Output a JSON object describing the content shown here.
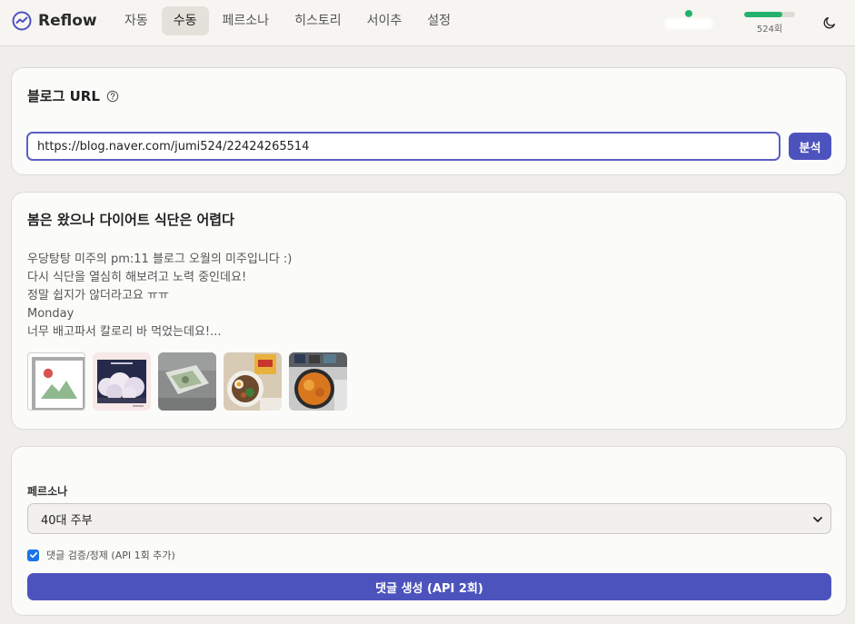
{
  "app": {
    "name": "Reflow"
  },
  "nav": {
    "tabs": [
      {
        "label": "자동",
        "active": false
      },
      {
        "label": "수동",
        "active": true
      },
      {
        "label": "페르소나",
        "active": false
      },
      {
        "label": "히스토리",
        "active": false
      },
      {
        "label": "서이추",
        "active": false
      },
      {
        "label": "설정",
        "active": false
      }
    ]
  },
  "status": {
    "connected": true
  },
  "usage": {
    "label": "524회",
    "fill_fraction": 0.75
  },
  "url_section": {
    "title": "블로그 URL",
    "url_value": "https://blog.naver.com/jumi524/22424265514",
    "analyze_label": "분석"
  },
  "post": {
    "title": "봄은 왔으나 다이어트 식단은 어렵다",
    "excerpt_lines": [
      "우당탕탕 미주의 pm:11 블로그 오월의 미주입니다 :)",
      "다시 식단을 열심히 해보려고 노력 중인데요!",
      "정말 쉽지가 않더라고요 ㅠㅠ",
      "Monday",
      "너무 배고파서 칼로리 바 먹었는데요!..."
    ],
    "thumbnails": [
      {
        "kind": "broken-image-icon"
      },
      {
        "kind": "cherry-blossom-night-photo"
      },
      {
        "kind": "snack-package-photo"
      },
      {
        "kind": "food-bowl-photo"
      },
      {
        "kind": "orange-soup-photo"
      }
    ]
  },
  "comment": {
    "persona_label": "페르소나",
    "persona_selected": "40대 주부",
    "verify_checked": true,
    "verify_label": "댓글 검증/정제 (API 1회 추가)",
    "generate_label": "댓글 생성 (API 2회)"
  },
  "colors": {
    "accent": "#4d53bd",
    "success": "#23b26b",
    "checkbox": "#1a73e8"
  }
}
